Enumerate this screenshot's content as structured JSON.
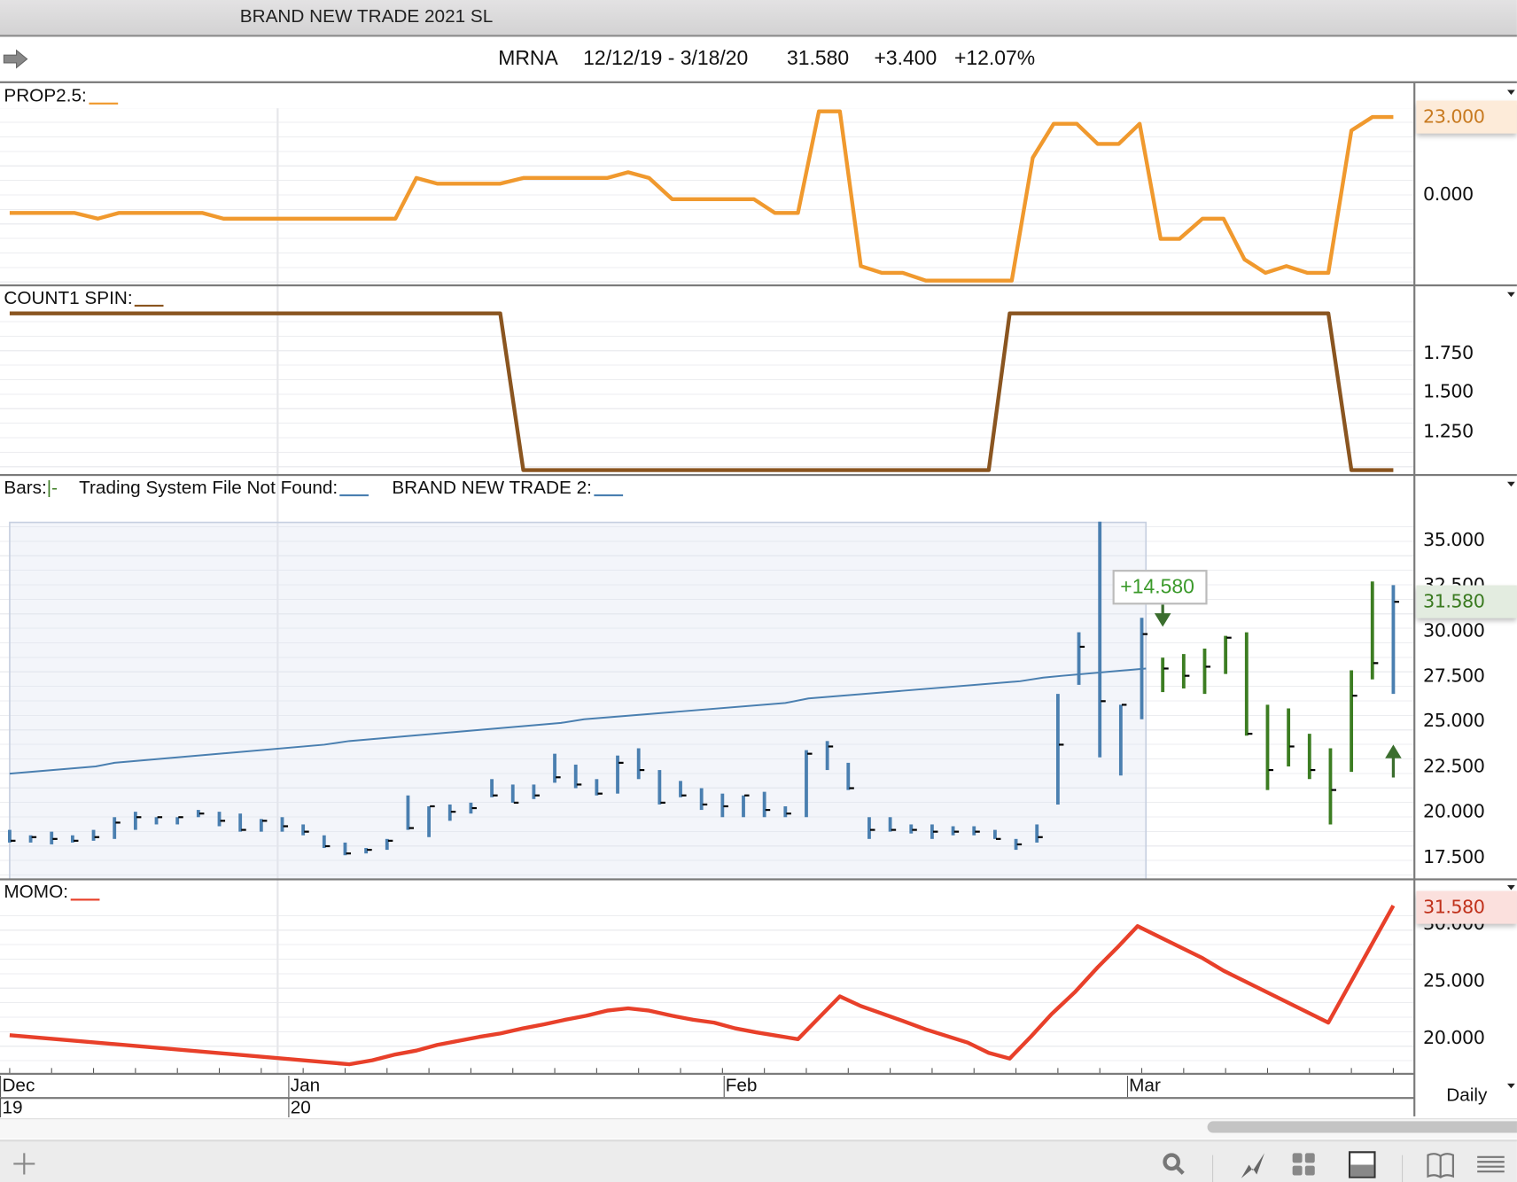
{
  "window": {
    "title": "BRAND NEW TRADE 2021 SL"
  },
  "info": {
    "symbol": "MRNA",
    "date_range": "12/12/19 - 3/18/20",
    "last": "31.580",
    "change": "+3.400",
    "change_pct": "+12.07%"
  },
  "colors": {
    "prop": "#f0992e",
    "count": "#8a5520",
    "bars_up": "#3c7d22",
    "bars": "#4a7fb0",
    "ma": "#4a7fb0",
    "momo": "#e8402a",
    "arrow": "#3b6e2e"
  },
  "panels": {
    "prop": {
      "legend": "PROP2.5:",
      "axis_labels": [
        {
          "v": 0,
          "t": "0.000"
        }
      ],
      "current": {
        "v": 23,
        "t": "23.000"
      }
    },
    "count": {
      "legend": "COUNT1 SPIN:",
      "axis_labels": [
        {
          "v": 1.75,
          "t": "1.750"
        },
        {
          "v": 1.5,
          "t": "1.500"
        },
        {
          "v": 1.25,
          "t": "1.250"
        }
      ]
    },
    "main": {
      "legend_bars": "Bars:",
      "legend_bars_glyph": "|-",
      "legend_ts": "Trading System File Not Found:",
      "legend_bnt": "BRAND NEW TRADE 2:",
      "axis_labels": [
        {
          "v": 35,
          "t": "35.000"
        },
        {
          "v": 32.5,
          "t": "32.500"
        },
        {
          "v": 30,
          "t": "30.000"
        },
        {
          "v": 27.5,
          "t": "27.500"
        },
        {
          "v": 25,
          "t": "25.000"
        },
        {
          "v": 22.5,
          "t": "22.500"
        },
        {
          "v": 20,
          "t": "20.000"
        },
        {
          "v": 17.5,
          "t": "17.500"
        }
      ],
      "current": {
        "v": 31.58,
        "t": "31.580"
      },
      "annotation": "+14.580"
    },
    "momo": {
      "legend": "MOMO:",
      "axis_labels": [
        {
          "v": 30,
          "t": "30.000"
        },
        {
          "v": 25,
          "t": "25.000"
        },
        {
          "v": 20,
          "t": "20.000"
        }
      ],
      "current": {
        "v": 31.58,
        "t": "31.580"
      }
    }
  },
  "xaxis": {
    "months": [
      {
        "idx": 0.55,
        "t": "Dec"
      },
      {
        "idx": 14.3,
        "t": "Jan"
      },
      {
        "idx": 35.05,
        "t": "Feb"
      },
      {
        "idx": 54.3,
        "t": "Mar"
      }
    ],
    "years": [
      {
        "idx": 0.55,
        "t": "19"
      },
      {
        "idx": 14.3,
        "t": "20"
      }
    ],
    "interval": "Daily"
  },
  "chart_data": [
    {
      "type": "line",
      "title": "PROP2.5",
      "x_unit": "bar index",
      "series": [
        {
          "name": "PROP2.5",
          "points": [
            [
              1,
              -5.5
            ],
            [
              4.1,
              -5.5
            ],
            [
              5.2,
              -7.2
            ],
            [
              6.2,
              -5.5
            ],
            [
              10.2,
              -5.5
            ],
            [
              11.2,
              -7.2
            ],
            [
              19.4,
              -7.2
            ],
            [
              20.4,
              4.9
            ],
            [
              21.4,
              3.2
            ],
            [
              24.4,
              3.2
            ],
            [
              25.5,
              4.9
            ],
            [
              29.5,
              4.9
            ],
            [
              30.5,
              6.6
            ],
            [
              31.5,
              4.9
            ],
            [
              32.6,
              -1.4
            ],
            [
              36.5,
              -1.4
            ],
            [
              37.5,
              -5.5
            ],
            [
              38.6,
              -5.5
            ],
            [
              39.6,
              24.7
            ],
            [
              40.6,
              24.7
            ],
            [
              41.6,
              -21.3
            ],
            [
              42.6,
              -23.3
            ],
            [
              43.6,
              -23.3
            ],
            [
              44.7,
              -25.6
            ],
            [
              48.8,
              -25.6
            ],
            [
              49.8,
              10.9
            ],
            [
              50.8,
              21
            ],
            [
              51.9,
              21
            ],
            [
              52.9,
              15
            ],
            [
              53.9,
              15
            ],
            [
              54.9,
              21
            ],
            [
              55.9,
              -13.2
            ],
            [
              56.8,
              -13.2
            ],
            [
              57.9,
              -7.2
            ],
            [
              58.9,
              -7.2
            ],
            [
              59.9,
              -19.3
            ],
            [
              60.9,
              -23.3
            ],
            [
              61.9,
              -21.3
            ],
            [
              62.9,
              -23.3
            ],
            [
              63.9,
              -23.3
            ],
            [
              65,
              19
            ],
            [
              66,
              23
            ],
            [
              67,
              23
            ]
          ]
        }
      ]
    },
    {
      "type": "line",
      "title": "COUNT1 SPIN",
      "x_unit": "bar index",
      "series": [
        {
          "name": "COUNT1 SPIN",
          "points": [
            [
              1,
              2
            ],
            [
              24.4,
              2
            ],
            [
              25.5,
              1
            ],
            [
              47.7,
              1
            ],
            [
              48.7,
              2
            ],
            [
              63.9,
              2
            ],
            [
              65,
              1
            ],
            [
              67,
              1
            ]
          ]
        }
      ]
    },
    {
      "type": "ohlc",
      "title": "MRNA daily bars",
      "x_unit": "bar index",
      "ylim": [
        17,
        36
      ],
      "bars": [
        [
          19.0,
          18.3,
          18.4
        ],
        [
          18.7,
          18.3,
          18.6
        ],
        [
          18.9,
          18.2,
          18.5
        ],
        [
          18.7,
          18.3,
          18.4
        ],
        [
          19.0,
          18.4,
          18.6
        ],
        [
          19.7,
          18.5,
          19.4
        ],
        [
          20.0,
          19.0,
          19.7
        ],
        [
          19.7,
          19.3,
          19.7
        ],
        [
          19.7,
          19.3,
          19.7
        ],
        [
          20.1,
          19.7,
          19.9
        ],
        [
          20.0,
          19.2,
          19.5
        ],
        [
          19.9,
          18.9,
          19.0
        ],
        [
          19.6,
          18.9,
          19.5
        ],
        [
          19.7,
          18.9,
          19.2
        ],
        [
          19.3,
          18.7,
          18.9
        ],
        [
          18.7,
          18.0,
          18.1
        ],
        [
          18.3,
          17.6,
          17.7
        ],
        [
          18.0,
          17.7,
          17.9
        ],
        [
          18.5,
          17.9,
          18.4
        ],
        [
          20.9,
          19.0,
          19.1
        ],
        [
          20.3,
          18.6,
          20.3
        ],
        [
          20.4,
          19.5,
          20.0
        ],
        [
          20.5,
          19.9,
          20.2
        ],
        [
          21.8,
          20.8,
          20.9
        ],
        [
          21.5,
          20.5,
          20.5
        ],
        [
          21.5,
          20.7,
          20.9
        ],
        [
          23.2,
          21.6,
          21.9
        ],
        [
          22.6,
          21.3,
          21.5
        ],
        [
          21.8,
          20.9,
          21.0
        ],
        [
          23.1,
          21.0,
          22.7
        ],
        [
          23.5,
          21.8,
          22.3
        ],
        [
          22.3,
          20.4,
          20.5
        ],
        [
          21.7,
          20.8,
          20.9
        ],
        [
          21.3,
          20.1,
          20.4
        ],
        [
          21.0,
          19.7,
          20.3
        ],
        [
          20.9,
          19.7,
          20.9
        ],
        [
          21.1,
          19.7,
          20.1
        ],
        [
          20.3,
          19.7,
          19.9
        ],
        [
          23.4,
          19.7,
          23.2
        ],
        [
          23.9,
          22.3,
          23.6
        ],
        [
          22.7,
          21.2,
          21.3
        ],
        [
          19.7,
          18.5,
          19.0
        ],
        [
          19.7,
          18.9,
          19.0
        ],
        [
          19.3,
          18.8,
          19.0
        ],
        [
          19.3,
          18.5,
          18.9
        ],
        [
          19.2,
          18.7,
          18.9
        ],
        [
          19.2,
          18.7,
          18.9
        ],
        [
          19.0,
          18.5,
          18.5
        ],
        [
          18.5,
          17.9,
          18.2
        ],
        [
          19.3,
          18.3,
          18.6
        ],
        [
          26.5,
          20.4,
          23.7
        ],
        [
          29.9,
          27.0,
          29.1
        ],
        [
          36.0,
          23.0,
          26.1
        ],
        [
          25.9,
          22.0,
          25.9
        ],
        [
          30.7,
          25.1,
          29.8
        ],
        [
          28.5,
          26.6,
          27.9
        ],
        [
          28.7,
          26.8,
          27.5
        ],
        [
          29.0,
          26.5,
          28.0
        ],
        [
          29.7,
          27.6,
          29.6
        ],
        [
          29.9,
          24.2,
          24.3
        ],
        [
          25.9,
          21.2,
          22.3
        ],
        [
          25.7,
          22.5,
          23.6
        ],
        [
          24.3,
          21.8,
          22.3
        ],
        [
          23.5,
          19.3,
          21.2
        ],
        [
          27.8,
          22.2,
          26.4
        ],
        [
          32.7,
          27.3,
          28.2
        ],
        [
          32.5,
          26.5,
          31.58
        ]
      ],
      "bar_fields": [
        "high",
        "low",
        "close"
      ],
      "trade_bars": [
        56,
        66
      ],
      "highlight_range": [
        1,
        55.2
      ],
      "moving_average": [
        [
          1,
          22.1
        ],
        [
          5.1,
          22.5
        ],
        [
          6,
          22.7
        ],
        [
          16,
          23.7
        ],
        [
          17.2,
          23.9
        ],
        [
          27.3,
          24.9
        ],
        [
          28.4,
          25.1
        ],
        [
          38,
          26.0
        ],
        [
          39.1,
          26.25
        ],
        [
          49.2,
          27.2
        ],
        [
          50.3,
          27.4
        ],
        [
          51.2,
          27.5
        ],
        [
          55.2,
          27.9
        ]
      ],
      "arrows": [
        {
          "idx": 56,
          "dir": "down",
          "v": 30.2
        },
        {
          "idx": 67,
          "dir": "up",
          "v": 23.7
        }
      ]
    },
    {
      "type": "line",
      "title": "MOMO",
      "x_unit": "bar index",
      "series": [
        {
          "name": "MOMO",
          "points": [
            [
              1,
              20.25
            ],
            [
              17.2,
              17.7
            ],
            [
              18.3,
              18.05
            ],
            [
              19.4,
              18.56
            ],
            [
              20.4,
              18.9
            ],
            [
              21.4,
              19.4
            ],
            [
              22.4,
              19.75
            ],
            [
              23.4,
              20.1
            ],
            [
              24.4,
              20.4
            ],
            [
              25.5,
              20.85
            ],
            [
              26.5,
              21.2
            ],
            [
              27.5,
              21.6
            ],
            [
              28.5,
              21.95
            ],
            [
              29.5,
              22.4
            ],
            [
              30.5,
              22.6
            ],
            [
              31.5,
              22.4
            ],
            [
              32.6,
              21.95
            ],
            [
              33.6,
              21.6
            ],
            [
              34.6,
              21.35
            ],
            [
              35.6,
              20.85
            ],
            [
              36.6,
              20.5
            ],
            [
              37.6,
              20.2
            ],
            [
              38.6,
              19.9
            ],
            [
              40.6,
              23.65
            ],
            [
              41.6,
              22.8
            ],
            [
              43.6,
              21.5
            ],
            [
              44.7,
              20.75
            ],
            [
              46.7,
              19.6
            ],
            [
              47.7,
              18.7
            ],
            [
              48.7,
              18.2
            ],
            [
              49.7,
              20.1
            ],
            [
              50.7,
              22.1
            ],
            [
              51.8,
              24.0
            ],
            [
              52.9,
              26.2
            ],
            [
              53.9,
              28.05
            ],
            [
              54.8,
              29.8
            ],
            [
              57.9,
              27.0
            ],
            [
              58.9,
              25.9
            ],
            [
              63.9,
              21.35
            ],
            [
              67,
              31.6
            ]
          ]
        }
      ]
    }
  ]
}
